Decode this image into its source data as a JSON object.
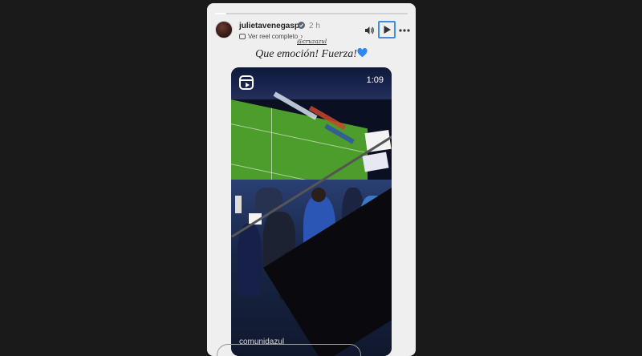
{
  "story": {
    "username": "julietavenegasp",
    "time_ago": "2 h",
    "reel_link_label": "Ver reel completo",
    "mention": "@cruzazul",
    "caption": "Que emoción! Fuerza!",
    "caption_emoji": "blue-heart-icon"
  },
  "controls": {
    "sound_icon": "speaker-icon",
    "play_icon": "play-icon",
    "more_icon": "more-horizontal-icon"
  },
  "video": {
    "duration": "1:09",
    "watermark": "comunidazul",
    "badge_icon": "reels-icon"
  },
  "colors": {
    "accent": "#3f8fe0",
    "heart": "#2f86f5",
    "page_bg": "#1a1a1a",
    "story_bg": "#efefef"
  }
}
